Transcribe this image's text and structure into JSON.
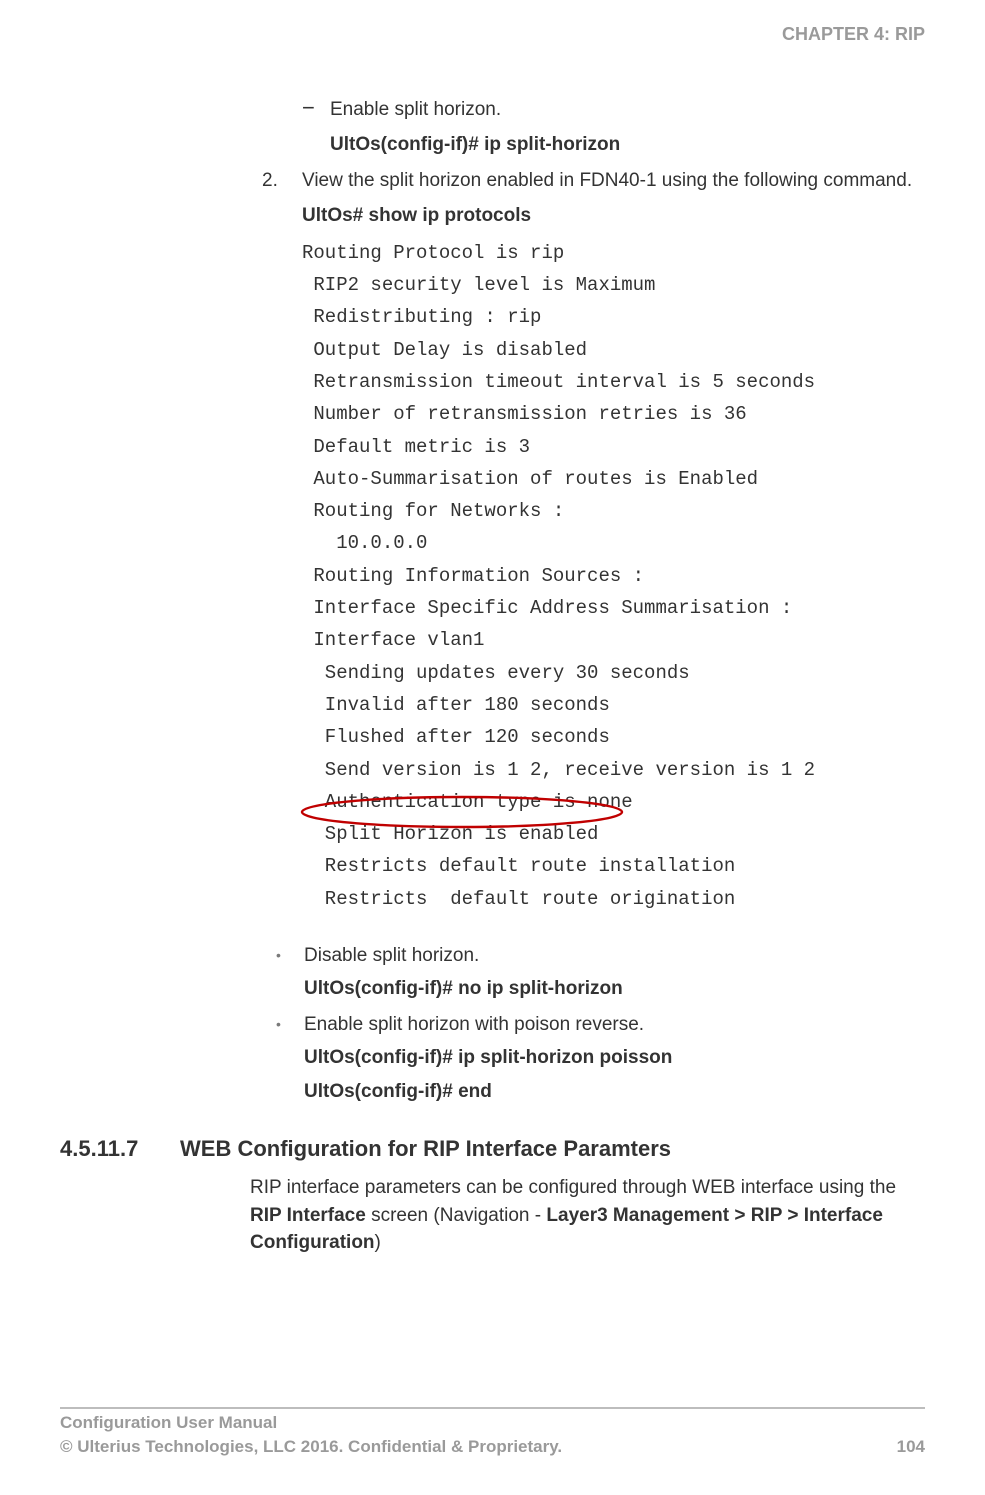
{
  "header": {
    "chapter": "CHAPTER 4: RIP"
  },
  "body": {
    "dash_bullet": "−",
    "enable_sh": "Enable split horizon.",
    "cmd1": "UltOs(config-if)# ip split-horizon",
    "step2_num": "2.",
    "step2_text": "View the split horizon enabled in FDN40-1 using the following command.",
    "cmd2": "UltOs# show ip protocols",
    "mono": "Routing Protocol is rip\n RIP2 security level is Maximum\n Redistributing : rip\n Output Delay is disabled\n Retransmission timeout interval is 5 seconds\n Number of retransmission retries is 36\n Default metric is 3\n Auto-Summarisation of routes is Enabled\n Routing for Networks :\n   10.0.0.0\n Routing Information Sources :\n Interface Specific Address Summarisation :\n Interface vlan1\n  Sending updates every 30 seconds\n  Invalid after 180 seconds\n  Flushed after 120 seconds\n  Send version is 1 2, receive version is 1 2\n  Authentication type is none\n  Split Horizon is enabled\n  Restricts default route installation\n  Restricts  default route origination",
    "dot": "•",
    "disable_sh": "Disable split horizon.",
    "cmd3": "UltOs(config-if)# no ip split-horizon",
    "enable_sh_poison": "Enable split horizon with poison reverse.",
    "cmd4": "UltOs(config-if)# ip split-horizon poisson",
    "cmd5": "UltOs(config-if)# end"
  },
  "section": {
    "num": "4.5.11.7",
    "title": "WEB Configuration for RIP Interface Paramters",
    "para_pre": "RIP interface parameters can be configured through WEB interface using the ",
    "para_b1": "RIP Interface",
    "para_mid": " screen (Navigation - ",
    "para_b2": "Layer3 Management > RIP > Interface Configuration",
    "para_post": ")"
  },
  "footer": {
    "line1": "Configuration User Manual",
    "line2": "© Ulterius Technologies, LLC 2016. Confidential & Proprietary.",
    "page": "104"
  }
}
